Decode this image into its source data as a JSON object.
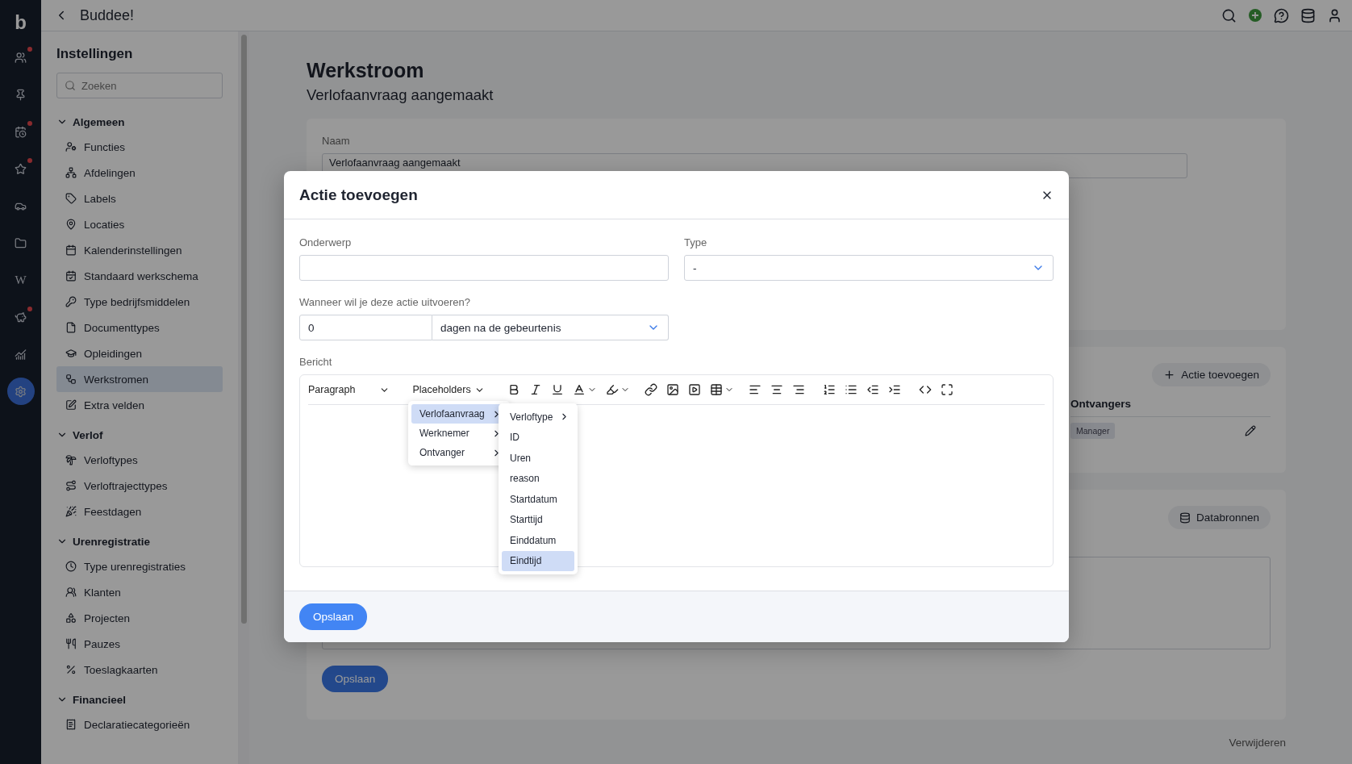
{
  "rail": {
    "logo": "b",
    "items": [
      {
        "badge": true,
        "selected": false
      },
      {
        "badge": false,
        "selected": false
      },
      {
        "badge": true,
        "selected": false
      },
      {
        "badge": true,
        "selected": false
      },
      {
        "badge": false,
        "selected": false
      },
      {
        "badge": false,
        "selected": false
      },
      {
        "badge": false,
        "selected": false,
        "text": "W"
      },
      {
        "badge": true,
        "selected": false
      },
      {
        "badge": false,
        "selected": false
      },
      {
        "badge": false,
        "selected": true
      }
    ]
  },
  "topbar": {
    "title": "Buddee!"
  },
  "sidebar": {
    "title": "Instellingen",
    "search": {
      "placeholder": "Zoeken"
    },
    "sections": [
      {
        "title": "Algemeen",
        "expanded": true,
        "items": [
          {
            "label": "Functies",
            "selected": false
          },
          {
            "label": "Afdelingen",
            "selected": false
          },
          {
            "label": "Labels",
            "selected": false
          },
          {
            "label": "Locaties",
            "selected": false
          },
          {
            "label": "Kalenderinstellingen",
            "selected": false
          },
          {
            "label": "Standaard werkschema",
            "selected": false
          },
          {
            "label": "Type bedrijfsmiddelen",
            "selected": false
          },
          {
            "label": "Documenttypes",
            "selected": false
          },
          {
            "label": "Opleidingen",
            "selected": false
          },
          {
            "label": "Werkstromen",
            "selected": true
          },
          {
            "label": "Extra velden",
            "selected": false
          }
        ]
      },
      {
        "title": "Verlof",
        "expanded": true,
        "items": [
          {
            "label": "Verloftypes",
            "selected": false
          },
          {
            "label": "Verloftrajecttypes",
            "selected": false
          },
          {
            "label": "Feestdagen",
            "selected": false
          }
        ]
      },
      {
        "title": "Urenregistratie",
        "expanded": true,
        "items": [
          {
            "label": "Type urenregistraties",
            "selected": false
          },
          {
            "label": "Klanten",
            "selected": false
          },
          {
            "label": "Projecten",
            "selected": false
          },
          {
            "label": "Pauzes",
            "selected": false
          },
          {
            "label": "Toeslagkaarten",
            "selected": false
          }
        ]
      },
      {
        "title": "Financieel",
        "expanded": true,
        "items": [
          {
            "label": "Declaratiecategorieën",
            "selected": false
          }
        ]
      }
    ]
  },
  "page": {
    "title": "Werkstroom",
    "subtitle": "Verlofaanvraag aangemaakt",
    "name_field": {
      "label": "Naam",
      "value": "Verlofaanvraag aangemaakt"
    },
    "actions": {
      "button": "Actie toevoegen",
      "column": "Ontvangers",
      "rows": [
        {
          "recipient": "Manager"
        }
      ]
    },
    "sources": {
      "button": "Databronnen",
      "save": "Opslaan"
    },
    "delete": "Verwijderen"
  },
  "modal": {
    "title": "Actie toevoegen",
    "subject": {
      "label": "Onderwerp"
    },
    "type": {
      "label": "Type",
      "value": "-"
    },
    "when": {
      "label": "Wanneer wil je deze actie uitvoeren?",
      "amount": "0",
      "unit": "dagen na de gebeurtenis"
    },
    "message": {
      "label": "Bericht",
      "format": "Paragraph",
      "placeholders": {
        "label": "Placeholders",
        "items": [
          {
            "label": "Verlofaanvraag",
            "selected": true,
            "submenu": true
          },
          {
            "label": "Werknemer",
            "selected": false,
            "submenu": true
          },
          {
            "label": "Ontvanger",
            "selected": false,
            "submenu": true
          }
        ],
        "subitems": [
          {
            "label": "Verloftype",
            "selected": false,
            "submenu": true
          },
          {
            "label": "ID",
            "selected": false,
            "submenu": false
          },
          {
            "label": "Uren",
            "selected": false,
            "submenu": false
          },
          {
            "label": "reason",
            "selected": false,
            "submenu": false
          },
          {
            "label": "Startdatum",
            "selected": false,
            "submenu": false
          },
          {
            "label": "Starttijd",
            "selected": false,
            "submenu": false
          },
          {
            "label": "Einddatum",
            "selected": false,
            "submenu": false
          },
          {
            "label": "Eindtijd",
            "selected": true,
            "submenu": false
          }
        ]
      }
    },
    "save": "Opslaan"
  }
}
